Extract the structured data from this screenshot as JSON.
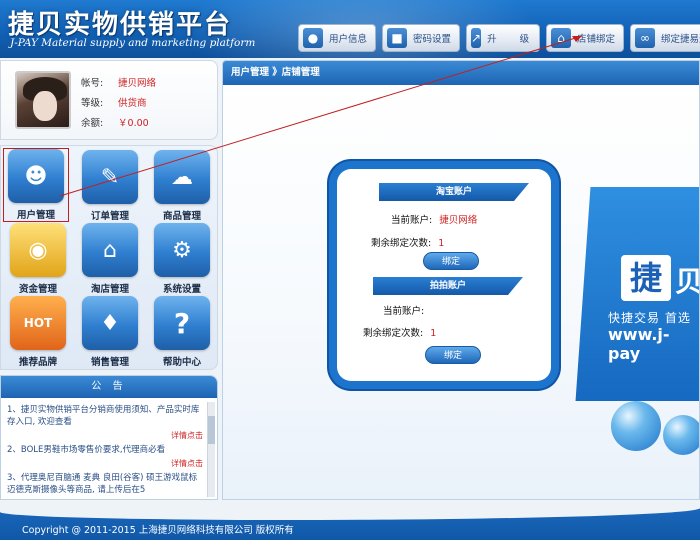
{
  "header": {
    "title": "捷贝实物供销平台",
    "subtitle": "J-PAY Material supply and marketing platform",
    "nav": [
      {
        "label": "用户信息",
        "icon": "user-icon"
      },
      {
        "label": "密码设置",
        "icon": "lock-icon"
      },
      {
        "label": "升  级",
        "icon": "chart-up-icon"
      },
      {
        "label": "店铺绑定",
        "icon": "house-icon"
      },
      {
        "label": "绑定捷易通",
        "icon": "link-icon"
      }
    ]
  },
  "user": {
    "account_label": "帐号:",
    "account_value": "捷贝网络",
    "level_label": "等级:",
    "level_value": "供货商",
    "balance_label": "余额:",
    "balance_value": "￥0.00"
  },
  "menu": [
    {
      "label": "用户管理",
      "icon": "user-manager-icon"
    },
    {
      "label": "订单管理",
      "icon": "order-icon"
    },
    {
      "label": "商品管理",
      "icon": "cart-icon"
    },
    {
      "label": "资金管理",
      "icon": "coins-icon"
    },
    {
      "label": "淘店管理",
      "icon": "shop-icon"
    },
    {
      "label": "系统设置",
      "icon": "gear-icon"
    },
    {
      "label": "推荐品牌",
      "icon": "hot-icon"
    },
    {
      "label": "销售管理",
      "icon": "sale-tag-icon"
    },
    {
      "label": "帮助中心",
      "icon": "help-icon"
    }
  ],
  "notice": {
    "title": "公 告",
    "items": [
      {
        "text": "1、捷贝实物供销平台分销商使用须知、产品实时库存入口, 欢迎查看",
        "link": "详情点击"
      },
      {
        "text": "2、BOLE男鞋市场零售价要求,代理商必看",
        "link": "详情点击"
      },
      {
        "text": "3、代理奥尼百脑通 麦典 良田(谷客) 硕王游戏鼠标 迈德克斯摄像头等商品, 请上传后在5",
        "link": ""
      }
    ]
  },
  "main": {
    "breadcrumb": "用户管理 》店铺管理",
    "taobao": {
      "title": "淘宝账户",
      "current_label": "当前账户:",
      "current_value": "捷贝网络",
      "remaining_label": "剩余绑定次数:",
      "remaining_value": "1",
      "button": "绑定"
    },
    "paipai": {
      "title": "拍拍账户",
      "current_label": "当前账户:",
      "current_value": "",
      "remaining_label": "剩余绑定次数:",
      "remaining_value": "1",
      "button": "绑定"
    },
    "brand": {
      "logo_char1": "捷",
      "logo_char2": "贝",
      "slogan": "快捷交易 首选",
      "url": "www.j-pay"
    }
  },
  "footer": {
    "copyright": "Copyright @ 2011-2015 上海捷贝网络科技有限公司 版权所有"
  }
}
